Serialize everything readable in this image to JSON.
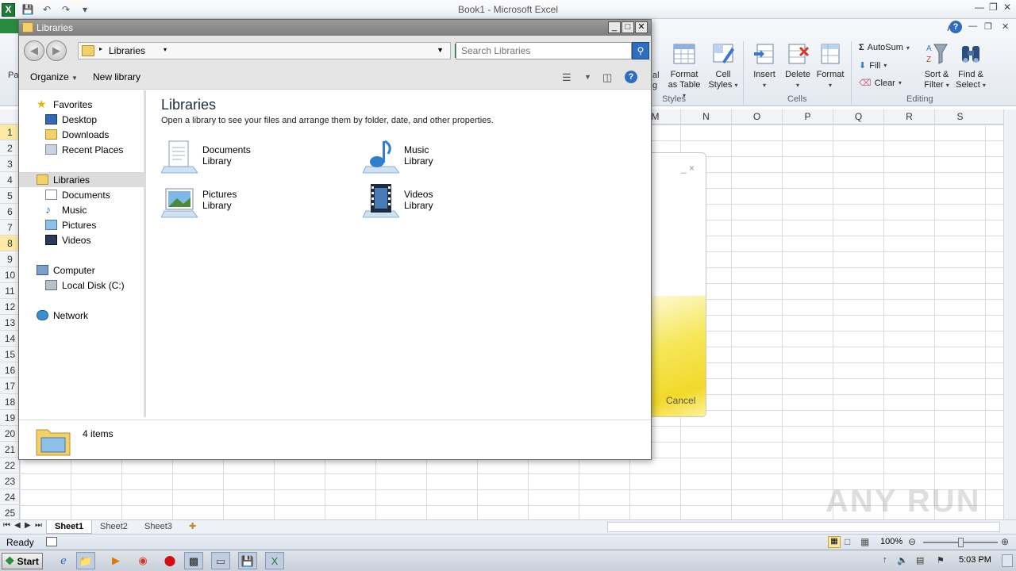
{
  "excel": {
    "window_title": "Book1 - Microsoft Excel",
    "file_tab": "F",
    "ribbon": {
      "partial_labels": [
        "Pa",
        "al",
        "g"
      ],
      "styles_group": {
        "label": "Styles",
        "buttons": [
          {
            "line1": "Format",
            "line2": "as Table"
          },
          {
            "line1": "Cell",
            "line2": "Styles"
          }
        ]
      },
      "cells_group": {
        "label": "Cells",
        "buttons": [
          {
            "line1": "Insert"
          },
          {
            "line1": "Delete"
          },
          {
            "line1": "Format"
          }
        ]
      },
      "editing_group": {
        "label": "Editing",
        "autosum": "AutoSum",
        "fill": "Fill",
        "clear": "Clear",
        "sort": {
          "line1": "Sort &",
          "line2": "Filter"
        },
        "find": {
          "line1": "Find &",
          "line2": "Select"
        }
      }
    },
    "columns": [
      "M",
      "N",
      "O",
      "P",
      "Q",
      "R",
      "S"
    ],
    "rows": [
      "1",
      "2",
      "3",
      "4",
      "5",
      "6",
      "7",
      "8",
      "9",
      "10",
      "11",
      "12",
      "13",
      "14",
      "15",
      "16",
      "17",
      "18",
      "19",
      "20",
      "21",
      "22",
      "23",
      "24",
      "25"
    ],
    "selected_rows": [
      "1",
      "8"
    ],
    "sheets": [
      "Sheet1",
      "Sheet2",
      "Sheet3"
    ],
    "active_sheet": "Sheet1",
    "status": "Ready",
    "zoom": "100%",
    "zoom_fraction": 0.5,
    "bg_dialog_cancel": "Cancel"
  },
  "explorer": {
    "title": "Libraries",
    "address": "Libraries",
    "search_placeholder": "Search Libraries",
    "commands": {
      "organize": "Organize",
      "new_library": "New library"
    },
    "nav": {
      "favorites": {
        "label": "Favorites",
        "items": [
          "Desktop",
          "Downloads",
          "Recent Places"
        ]
      },
      "libraries": {
        "label": "Libraries",
        "items": [
          "Documents",
          "Music",
          "Pictures",
          "Videos"
        ]
      },
      "computer": {
        "label": "Computer",
        "items": [
          "Local Disk (C:)"
        ]
      },
      "network": {
        "label": "Network"
      }
    },
    "content": {
      "heading": "Libraries",
      "description": "Open a library to see your files and arrange them by folder, date, and other properties.",
      "libraries": [
        {
          "name": "Documents",
          "type": "Library",
          "icon": "documents-library-icon"
        },
        {
          "name": "Music",
          "type": "Library",
          "icon": "music-library-icon"
        },
        {
          "name": "Pictures",
          "type": "Library",
          "icon": "pictures-library-icon"
        },
        {
          "name": "Videos",
          "type": "Library",
          "icon": "videos-library-icon"
        }
      ]
    },
    "details": {
      "count": "4 items"
    }
  },
  "taskbar": {
    "start": "Start",
    "time": "5:03 PM"
  },
  "watermark": "ANY RUN",
  "colors": {
    "accent": "#2e6dbf",
    "excel_green": "#1e7a38",
    "folder": "#f3d16a"
  }
}
